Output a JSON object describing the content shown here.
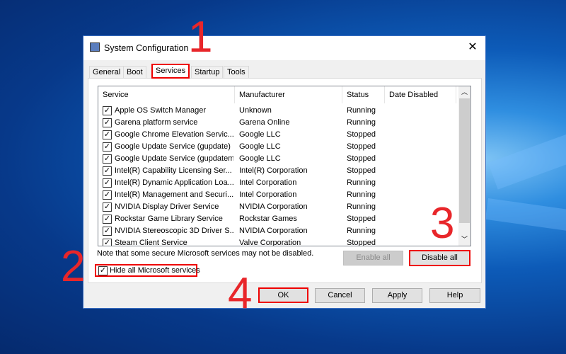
{
  "window": {
    "title": "System Configuration",
    "close_icon": "close-icon"
  },
  "tabs": [
    "General",
    "Boot",
    "Services",
    "Startup",
    "Tools"
  ],
  "active_tab": "Services",
  "columns": [
    "Service",
    "Manufacturer",
    "Status",
    "Date Disabled"
  ],
  "rows": [
    {
      "checked": true,
      "service": "Apple OS Switch Manager",
      "manufacturer": "Unknown",
      "status": "Running"
    },
    {
      "checked": true,
      "service": "Garena platform service",
      "manufacturer": "Garena Online",
      "status": "Running"
    },
    {
      "checked": true,
      "service": "Google Chrome Elevation Servic...",
      "manufacturer": "Google LLC",
      "status": "Stopped"
    },
    {
      "checked": true,
      "service": "Google Update Service (gupdate)",
      "manufacturer": "Google LLC",
      "status": "Stopped"
    },
    {
      "checked": true,
      "service": "Google Update Service (gupdatem)",
      "manufacturer": "Google LLC",
      "status": "Stopped"
    },
    {
      "checked": true,
      "service": "Intel(R) Capability Licensing Ser...",
      "manufacturer": "Intel(R) Corporation",
      "status": "Stopped"
    },
    {
      "checked": true,
      "service": "Intel(R) Dynamic Application Loa...",
      "manufacturer": "Intel Corporation",
      "status": "Running"
    },
    {
      "checked": true,
      "service": "Intel(R) Management and Securi...",
      "manufacturer": "Intel Corporation",
      "status": "Running"
    },
    {
      "checked": true,
      "service": "NVIDIA Display Driver Service",
      "manufacturer": "NVIDIA Corporation",
      "status": "Running"
    },
    {
      "checked": true,
      "service": "Rockstar Game Library Service",
      "manufacturer": "Rockstar Games",
      "status": "Stopped"
    },
    {
      "checked": true,
      "service": "NVIDIA Stereoscopic 3D Driver S...",
      "manufacturer": "NVIDIA Corporation",
      "status": "Running"
    },
    {
      "checked": true,
      "service": "Steam Client Service",
      "manufacturer": "Valve Corporation",
      "status": "Stopped"
    }
  ],
  "note": "Note that some secure Microsoft services may not be disabled.",
  "enable_all": "Enable all",
  "disable_all": "Disable all",
  "hide_ms": {
    "label": "Hide all Microsoft services",
    "checked": true
  },
  "buttons": {
    "ok": "OK",
    "cancel": "Cancel",
    "apply": "Apply",
    "help": "Help"
  },
  "annotations": [
    "1",
    "2",
    "3",
    "4"
  ],
  "colors": {
    "annotation": "#e8262a"
  }
}
